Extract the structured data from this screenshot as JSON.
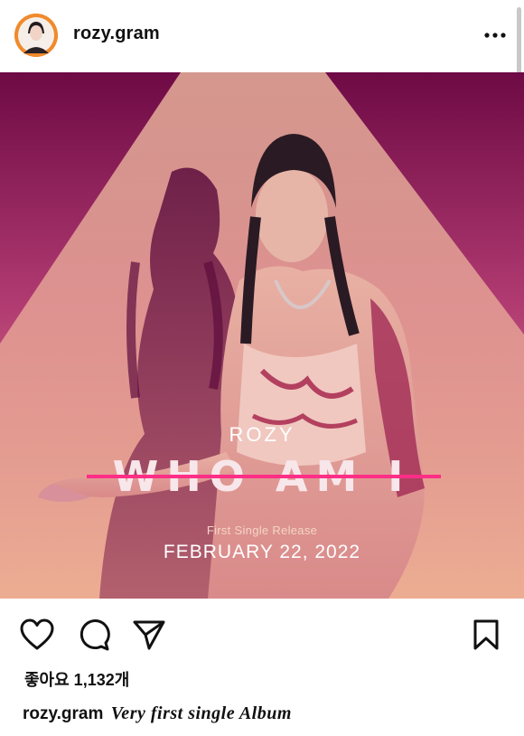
{
  "header": {
    "username": "rozy.gram",
    "avatar_icon": "profile-avatar",
    "more_icon": "more-horizontal-icon"
  },
  "post": {
    "image_text": {
      "artist": "ROZY",
      "title": "WHO AM I",
      "subtitle": "First Single Release",
      "date": "FEBRUARY 22, 2022"
    },
    "colors": {
      "bg_top": "#7a0f4e",
      "bg_mid": "#c24a7c",
      "bg_bottom": "#e4a08a",
      "accent": "#ff2e86"
    }
  },
  "actions": {
    "like_icon": "heart-icon",
    "comment_icon": "comment-icon",
    "share_icon": "send-icon",
    "save_icon": "bookmark-icon"
  },
  "likes": {
    "label": "좋아요 1,132개"
  },
  "caption": {
    "username": "rozy.gram",
    "text": "Very first single Album"
  }
}
